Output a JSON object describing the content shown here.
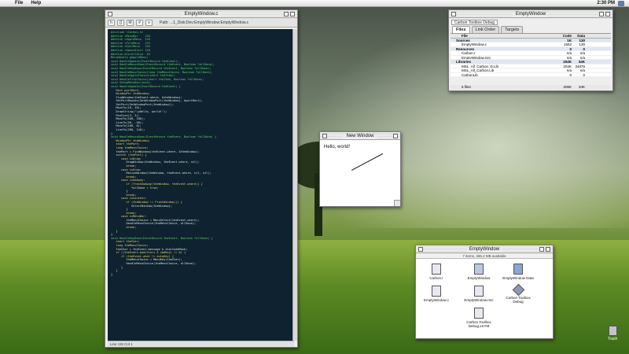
{
  "menubar": {
    "items": [
      "File",
      "Help"
    ],
    "clock": "2:30 PM"
  },
  "editor": {
    "title": "EmptyWindow.c",
    "path": "Path: ...1_Disk:Dev:EmptyWindow:EmptyWindow.c",
    "status": "Line 115    Col 1",
    "code": [
      "#include <Carbon.h>",
      "",
      "#define rMenuBar    128",
      "#define rAppleMenu  128",
      "#define rFileMenu   129",
      "#define rEditMenu   130",
      "#define rAboutAlert 128",
      "#define kScrollSize  16",
      "",
      "MenuHandle gAppleMenu;",
      "",
      "void HandleUpdate(EventRecord theEvent);",
      "void HandleMouseDown(EventRecord theEvent, Boolean *allDone);",
      "void HandleKeyDown(EventRecord theEvent, Boolean *allDone);",
      "void HandleMenuChoice(long theMenuChoice, Boolean *allDone);",
      "void HandleAppleChoice(short theItem);",
      "void HandleFileChoice(short theItem, Boolean *allDone);",
      "void SetupMenuBar(void);",
      "",
      "void HandleUpdate(EventRecord theEvent) {",
      "   Rect portRect;",
      "   WindowPtr theWindow;",
      "",
      "   FindWindow(theEvent.where, &theWindow);",
      "",
      "   GetPortBounds(GetWindowPort(theWindow), &portRect);",
      "   SetPort(GetWindowPort(theWindow));",
      "   MoveTo(10, 20);",
      "   DrawString(\"\\pHello, world!\");",
      "",
      "   PenSize(3, 3);",
      "   MoveTo(100, 100);",
      "   LineTo(50, -50);",
      "   MoveTo(100, 0);",
      "   LineTo(200, 140);",
      "}",
      "",
      "void HandleMouseDown(EventRecord theEvent, Boolean *allDone) {",
      "   WindowPtr theWindow;",
      "   short thePart;",
      "   long theMenuChoice;",
      "",
      "   thePart = FindWindow(theEvent.where, &theWindow);",
      "",
      "   switch (thePart) {",
      "      case inDrag:",
      "         DragWindow(theWindow, theEvent.where, nil);",
      "         break;",
      "",
      "      case inGrow:",
      "         ResizeWindow(theWindow, theEvent.where, nil, nil);",
      "         break;",
      "",
      "      case inGoAway:",
      "         if (TrackGoAway(theWindow, theEvent.where)) {",
      "            *allDone = true;",
      "         }",
      "         break;",
      "",
      "      case inContent:",
      "         if (theWindow != FrontWindow()) {",
      "            SelectWindow(theWindow);",
      "         }",
      "         break;",
      "",
      "      case inMenuBar:",
      "         theMenuChoice = MenuSelect(theEvent.where);",
      "         HandleMenuChoice(theMenuChoice, allDone);",
      "         break;",
      "   }",
      "}",
      "",
      "void HandleKeyDown(EventRecord theEvent, Boolean *allDone) {",
      "   short theChar;",
      "   long theMenuChoice;",
      "",
      "   theChar = theEvent.message & charCodeMask;",
      "",
      "   if ((theEvent.modifiers & cmdKey) != 0) {",
      "      if (theEvent.what != autoKey) {",
      "         theMenuChoice = MenuKey(theChar);",
      "         HandleMenuChoice(theMenuChoice, allDone);",
      "      }",
      "   }",
      "}"
    ]
  },
  "new_window": {
    "title": "New Window",
    "text": "Hello, world!"
  },
  "project": {
    "title": "EmptyWindow",
    "target": "Carbon Toolbox Debug",
    "tabs": [
      "Files",
      "Link Order",
      "Targets"
    ],
    "active_tab": "Files",
    "headers": {
      "file": "File",
      "code": "Code",
      "data": "Data"
    },
    "rows": [
      {
        "name": "Sources",
        "code": "1K",
        "data": "130",
        "group": true
      },
      {
        "name": "EmptyWindow.c",
        "code": "1552",
        "data": "130",
        "group": false
      },
      {
        "name": "Resources",
        "code": "0",
        "data": "0",
        "group": true
      },
      {
        "name": "Carbon.r",
        "code": "n/a",
        "data": "n/a",
        "group": false
      },
      {
        "name": "EmptyWindow.rsrc",
        "code": "n/a",
        "data": "n/a",
        "group": false
      },
      {
        "name": "Libraries",
        "code": "204K",
        "data": "34K",
        "group": true
      },
      {
        "name": "MSL_All_Carbon_D.Lib",
        "code": "204K",
        "data": "34876",
        "group": false
      },
      {
        "name": "MSL_All_Carbon.Lib",
        "code": "n/a",
        "data": "n/a",
        "group": false
      },
      {
        "name": "CarbonLib",
        "code": "0",
        "data": "0",
        "group": false
      }
    ],
    "footer": {
      "label": "6 files",
      "code": "206K",
      "data": "34K"
    }
  },
  "finder": {
    "title": "EmptyWindow",
    "info": "7 items, 465.2 MB available",
    "items": [
      {
        "label": "Carbon.r",
        "icon": "document-icon"
      },
      {
        "label": "EmptyWindow",
        "icon": "application-icon"
      },
      {
        "label": "EmptyWindow Data",
        "icon": "folder-icon"
      },
      {
        "label": "EmptyWindow.c",
        "icon": "document-icon"
      },
      {
        "label": "EmptyWindow.rsrc",
        "icon": "resource-file-icon"
      },
      {
        "label": "Carbon Toolbox Debug",
        "icon": "project-diamond-icon"
      },
      {
        "label": "Carbon Toolbox Debug.xSYM",
        "icon": "document-icon"
      }
    ]
  },
  "trash": {
    "label": "Trash"
  }
}
